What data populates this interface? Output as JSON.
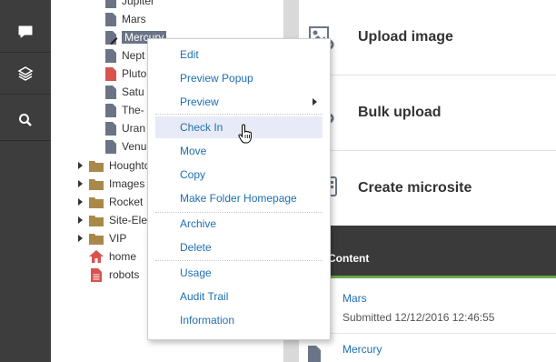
{
  "rail": {
    "icons": [
      "chat-icon",
      "layers-icon",
      "search-icon"
    ]
  },
  "tree": {
    "items": [
      {
        "label": "Jupiter",
        "type": "page"
      },
      {
        "label": "Mars",
        "type": "page"
      },
      {
        "label": "Mercury",
        "type": "page-selected"
      },
      {
        "label": "Nept",
        "type": "page"
      },
      {
        "label": "Pluto",
        "type": "page-red"
      },
      {
        "label": "Satu",
        "type": "page"
      },
      {
        "label": "The-",
        "type": "page"
      },
      {
        "label": "Uran",
        "type": "page"
      },
      {
        "label": "Venu",
        "type": "page"
      },
      {
        "label": "Houghto",
        "type": "folder"
      },
      {
        "label": "Images",
        "type": "folder"
      },
      {
        "label": "Rocket",
        "type": "folder"
      },
      {
        "label": "Site-Ele",
        "type": "folder"
      },
      {
        "label": "VIP",
        "type": "folder"
      },
      {
        "label": "home",
        "type": "home"
      },
      {
        "label": "robots",
        "type": "doc-red"
      }
    ]
  },
  "actions": [
    {
      "title": "Upload image",
      "icon": "image-add-icon"
    },
    {
      "title": "Bulk upload",
      "icon": "bulk-upload-icon"
    },
    {
      "title": "Create microsite",
      "icon": "microsite-icon"
    }
  ],
  "content": {
    "header": "Content",
    "items": [
      {
        "title": "Mars",
        "subtitle": "Submitted 12/12/2016 12:46:55"
      },
      {
        "title": "Mercury",
        "subtitle": ""
      }
    ]
  },
  "context_menu": {
    "groups": [
      [
        "Edit",
        "Preview Popup",
        "Preview",
        "Check In",
        "Move",
        "Copy",
        "Make Folder Homepage"
      ],
      [
        "Archive",
        "Delete"
      ],
      [
        "Usage",
        "Audit Trail",
        "Information"
      ]
    ],
    "hovered": "Check In",
    "submenu_item": "Preview"
  },
  "colors": {
    "link": "#1f6fb2",
    "rail": "#3d3d3d",
    "hover": "#e8ebf7",
    "accent_green": "#6aa84f"
  }
}
